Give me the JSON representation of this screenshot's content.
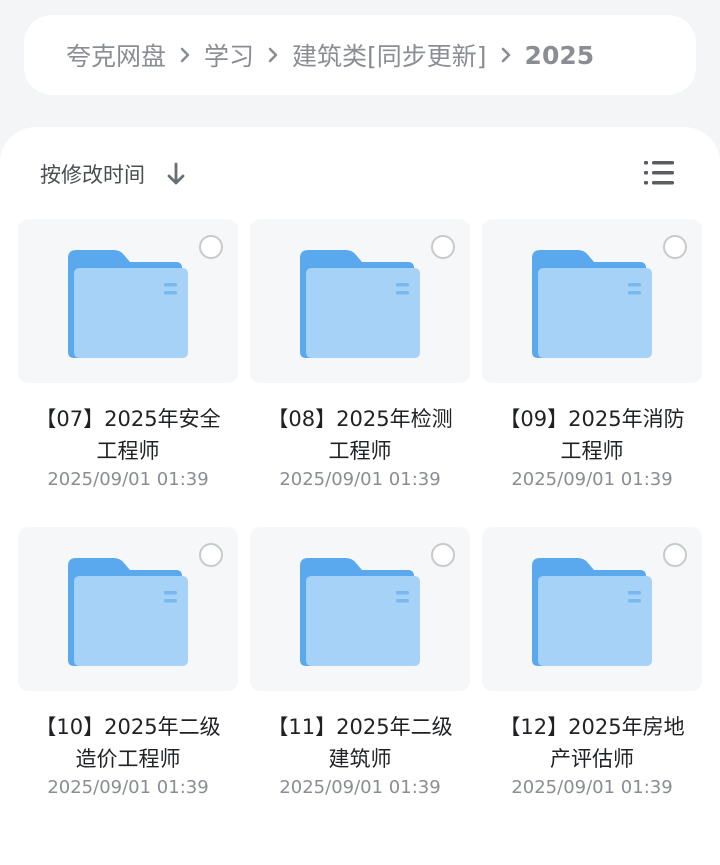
{
  "breadcrumb": {
    "items": [
      "夸克网盘",
      "学习",
      "建筑类[同步更新]",
      "2025"
    ]
  },
  "toolbar": {
    "sort_label": "按修改时间",
    "sort_icon": "arrow-down-icon",
    "view_icon": "list-view-icon"
  },
  "files": [
    {
      "name": "【07】2025年安全工程师",
      "modified": "2025/09/01 01:39",
      "icon": "folder-icon"
    },
    {
      "name": "【08】2025年检测工程师",
      "modified": "2025/09/01 01:39",
      "icon": "folder-icon"
    },
    {
      "name": "【09】2025年消防工程师",
      "modified": "2025/09/01 01:39",
      "icon": "folder-icon"
    },
    {
      "name": "【10】2025年二级造价工程师",
      "modified": "2025/09/01 01:39",
      "icon": "folder-icon"
    },
    {
      "name": "【11】2025年二级建筑师",
      "modified": "2025/09/01 01:39",
      "icon": "folder-icon"
    },
    {
      "name": "【12】2025年房地产评估师",
      "modified": "2025/09/01 01:39",
      "icon": "folder-icon"
    }
  ],
  "colors": {
    "folder_back": "#5aa9ee",
    "folder_front": "#9ccdf7",
    "accent_text": "#8a8d93"
  }
}
